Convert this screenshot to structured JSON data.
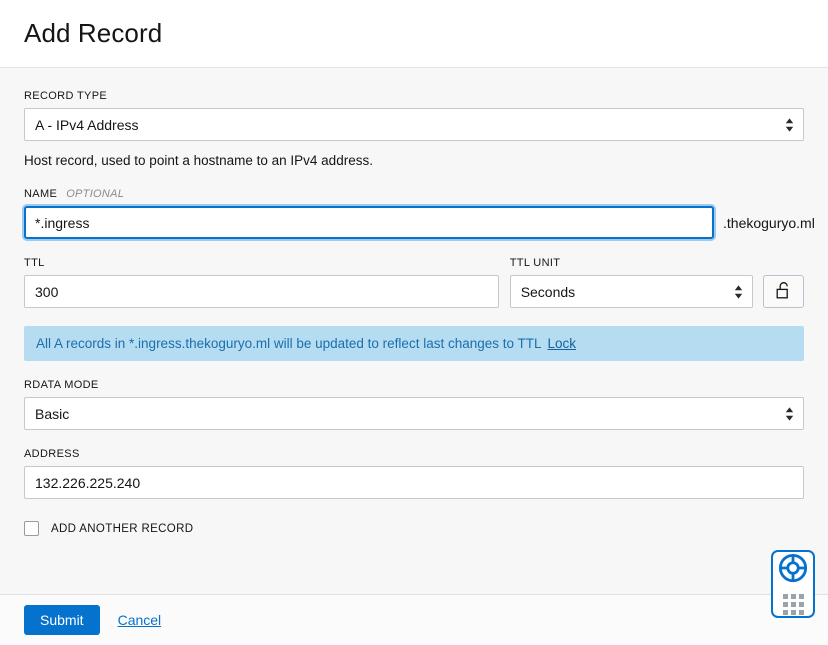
{
  "header": {
    "title": "Add Record"
  },
  "form": {
    "record_type": {
      "label": "RECORD TYPE",
      "value": "A - IPv4 Address",
      "helper": "Host record, used to point a hostname to an IPv4 address."
    },
    "name": {
      "label": "NAME",
      "optional_tag": "OPTIONAL",
      "value": "*.ingress",
      "suffix": ".thekoguryo.ml"
    },
    "ttl": {
      "label": "TTL",
      "value": "300"
    },
    "ttl_unit": {
      "label": "TTL UNIT",
      "value": "Seconds"
    },
    "lock_button": {
      "icon": "unlocked-padlock-icon"
    },
    "banner": {
      "message": "All A records in *.ingress.thekoguryo.ml will be updated to reflect last changes to TTL",
      "link_label": "Lock",
      "background": "#b6dcf2",
      "text_color": "#1a6fad"
    },
    "rdata_mode": {
      "label": "RDATA MODE",
      "value": "Basic"
    },
    "address": {
      "label": "ADDRESS",
      "value": "132.226.225.240"
    },
    "add_another": {
      "label": "ADD ANOTHER RECORD",
      "checked": false
    }
  },
  "footer": {
    "submit_label": "Submit",
    "cancel_label": "Cancel",
    "accent_color": "#0572ce"
  },
  "support_widget": {
    "icon": "life-ring-icon",
    "grid_icon": "grid-dots-icon"
  }
}
